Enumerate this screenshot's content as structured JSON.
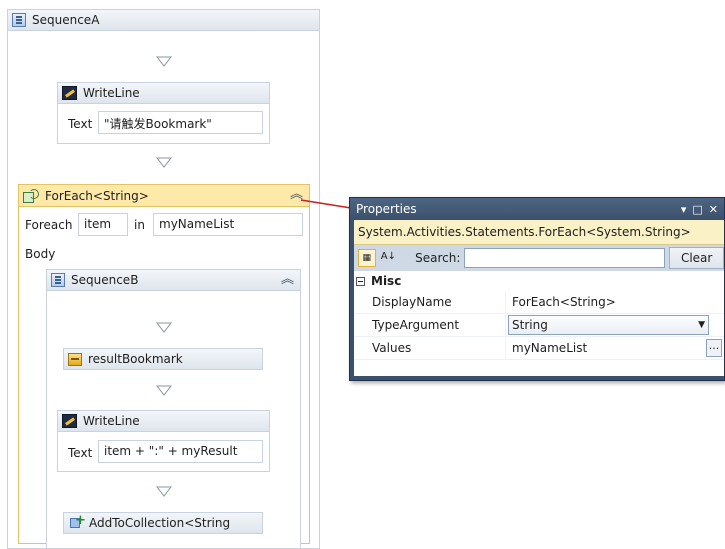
{
  "sequence_a": {
    "title": "SequenceA"
  },
  "writeline_1": {
    "title": "WriteLine",
    "text_label": "Text",
    "text_value": "\"请触发Bookmark\""
  },
  "foreach": {
    "title": "ForEach<String>",
    "foreach_label": "Foreach",
    "item_value": "item",
    "in_label": "in",
    "collection_value": "myNameList",
    "body_label": "Body"
  },
  "sequence_b": {
    "title": "SequenceB"
  },
  "result_bookmark": {
    "title": "resultBookmark"
  },
  "writeline_2": {
    "title": "WriteLine",
    "text_label": "Text",
    "text_value": "item + \":\" + myResult"
  },
  "add_to_collection": {
    "title": "AddToCollection<String"
  },
  "properties": {
    "title": "Properties",
    "type_name": "System.Activities.Statements.ForEach<System.String>",
    "search_label": "Search:",
    "search_value": "",
    "clear_label": "Clear",
    "category": "Misc",
    "rows": [
      {
        "name": "DisplayName",
        "value": "ForEach<String>"
      },
      {
        "name": "TypeArgument",
        "value": "String"
      },
      {
        "name": "Values",
        "value": "myNameList"
      }
    ],
    "ellipsis_label": "..."
  },
  "colors": {
    "foreach_header": "#ffe9a8",
    "foreach_border": "#e5c365",
    "properties_frame": "#3b506a",
    "link_line": "#cc1f1f"
  }
}
